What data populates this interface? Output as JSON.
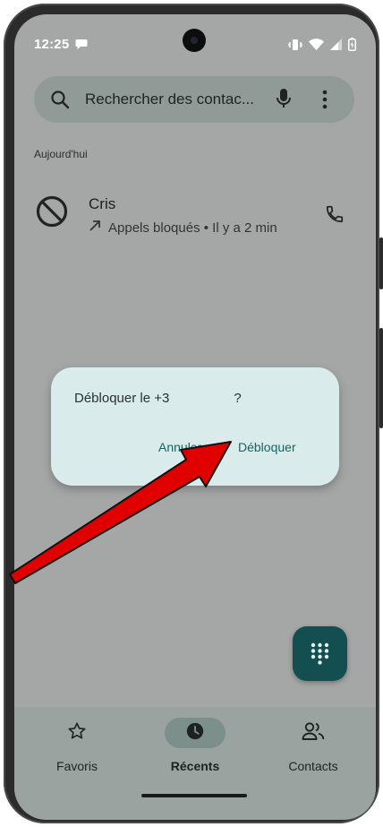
{
  "status_bar": {
    "time": "12:25"
  },
  "search": {
    "placeholder": "Rechercher des contac..."
  },
  "section_today": "Aujourd'hui",
  "call_log": [
    {
      "name": "Cris",
      "detail": "Appels bloqués • Il y a 2 min"
    }
  ],
  "dialog": {
    "title_prefix": "Débloquer le +3",
    "title_suffix": "?",
    "cancel_label": "Annuler",
    "confirm_label": "Débloquer"
  },
  "nav": {
    "items": [
      {
        "label": "Favoris",
        "icon": "star-icon",
        "active": false
      },
      {
        "label": "Récents",
        "icon": "clock-icon",
        "active": true
      },
      {
        "label": "Contacts",
        "icon": "people-icon",
        "active": false
      }
    ]
  },
  "colors": {
    "accent": "#136565",
    "fab": "#134e51",
    "arrow": "#e00000"
  }
}
